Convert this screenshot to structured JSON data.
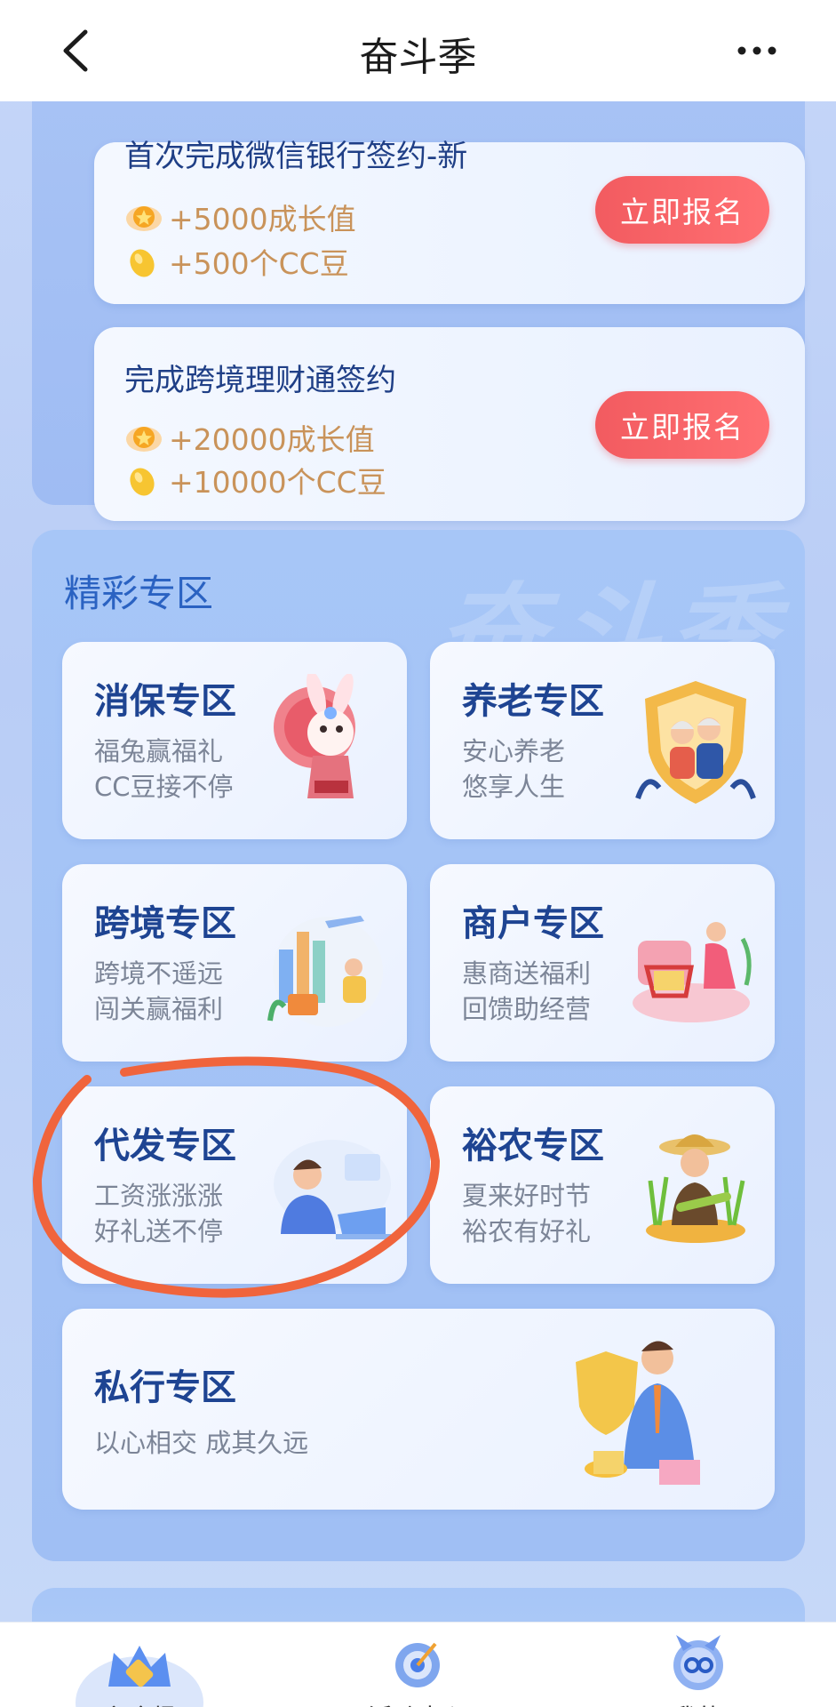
{
  "header": {
    "title": "奋斗季"
  },
  "tasks": [
    {
      "title": "首次完成微信银行签约-新",
      "reward_growth": "+5000成长值",
      "reward_beans": "+500个CC豆",
      "button": "立即报名"
    },
    {
      "title": "完成跨境理财通签约",
      "reward_growth": "+20000成长值",
      "reward_beans": "+10000个CC豆",
      "button": "立即报名"
    }
  ],
  "section": {
    "title": "精彩专区",
    "watermark": "奋斗季"
  },
  "zones": [
    {
      "title": "消保专区",
      "line1": "福兔赢福礼",
      "line2": "CC豆接不停"
    },
    {
      "title": "养老专区",
      "line1": "安心养老",
      "line2": "悠享人生"
    },
    {
      "title": "跨境专区",
      "line1": "跨境不遥远",
      "line2": "闯关赢福利"
    },
    {
      "title": "商户专区",
      "line1": "惠商送福利",
      "line2": "回馈助经营"
    },
    {
      "title": "代发专区",
      "line1": "工资涨涨涨",
      "line2": "好礼送不停"
    },
    {
      "title": "裕农专区",
      "line1": "夏来好时节",
      "line2": "裕农有好礼"
    },
    {
      "title": "私行专区",
      "line1": "以心相交 成其久远"
    }
  ],
  "tabbar": [
    {
      "label": "主会场",
      "icon": "crown-icon"
    },
    {
      "label": "活动中心",
      "icon": "target-icon"
    },
    {
      "label": "我的",
      "icon": "cc-mascot-icon"
    }
  ],
  "colors": {
    "accent": "#2a62c2",
    "button": "#f25b60",
    "annotation": "#f0643c"
  }
}
